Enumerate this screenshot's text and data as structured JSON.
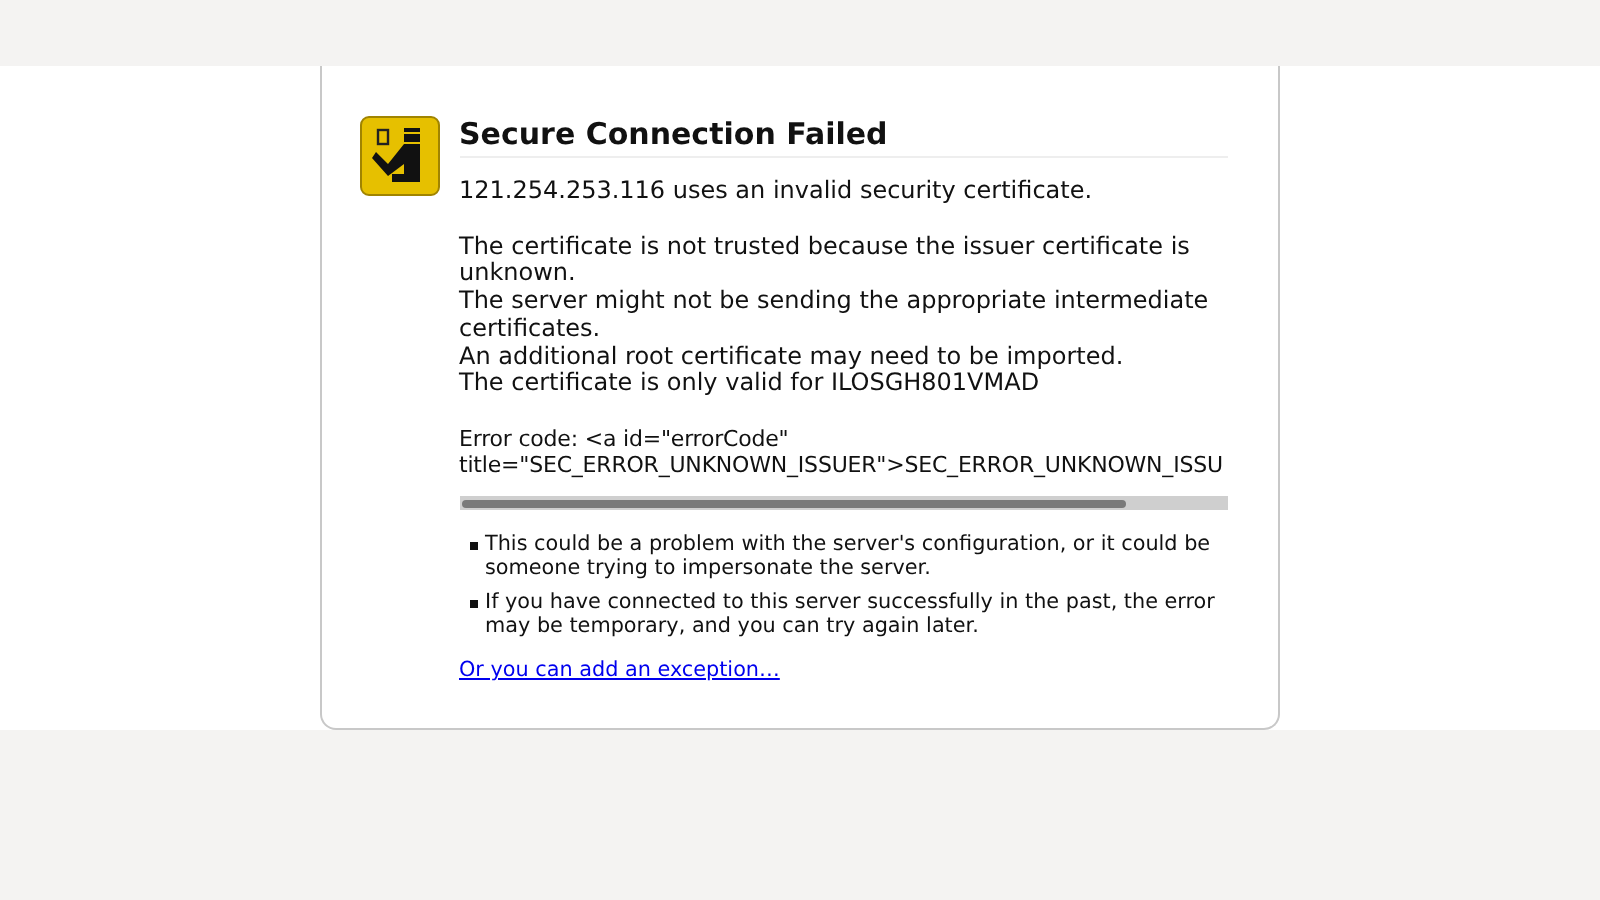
{
  "title": "Secure Connection Failed",
  "summary": "121.254.253.116 uses an invalid security certificate.",
  "details": [
    "The certificate is not trusted because the issuer certificate is",
    "unknown.",
    "The server might not be sending the appropriate intermediate",
    "certificates.",
    "An additional root certificate may need to be imported.",
    "The certificate is only valid for ILOSGH801VMAD"
  ],
  "error_code": [
    "Error code: <a id=\"errorCode\"",
    "title=\"SEC_ERROR_UNKNOWN_ISSUER\">SEC_ERROR_UNKNOWN_ISSU"
  ],
  "bullets": [
    [
      "This could be a problem with the server's configuration, or it could be",
      "someone trying to impersonate the server."
    ],
    [
      "If you have connected to this server successfully in the past, the error",
      "may be temporary, and you can try again later."
    ]
  ],
  "exception_link": "Or you can add an exception…"
}
